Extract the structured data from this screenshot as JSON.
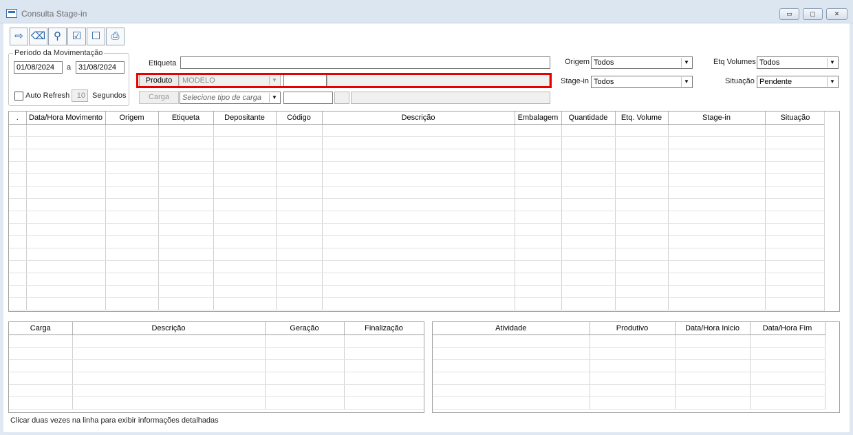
{
  "window": {
    "title": "Consulta Stage-in",
    "minimize": "▭",
    "maximize": "▢",
    "close": "✕"
  },
  "toolbar": [
    {
      "name": "exit-icon",
      "glyph": "⇨"
    },
    {
      "name": "eraser-icon",
      "glyph": "⌫"
    },
    {
      "name": "search-icon",
      "glyph": "⚲"
    },
    {
      "name": "check-list-icon",
      "glyph": "☑"
    },
    {
      "name": "uncheck-list-icon",
      "glyph": "☐"
    },
    {
      "name": "print-icon",
      "glyph": "⎙"
    }
  ],
  "periodo": {
    "label": "Período da Movimentação",
    "start": "01/08/2024",
    "sep": "a",
    "end": "31/08/2024"
  },
  "auto_refresh": {
    "label": "Auto Refresh",
    "seconds": "10",
    "unit": "Segundos"
  },
  "filters": {
    "etiqueta_label": "Etiqueta",
    "produto_button": "Produto",
    "produto_combo": "MODELO",
    "carga_button": "Carga",
    "carga_combo": "Selecione tipo de carga",
    "origem_label": "Origem",
    "origem_value": "Todos",
    "stagein_label": "Stage-in",
    "stagein_value": "Todos",
    "etq_volumes_label": "Etq Volumes",
    "etq_volumes_value": "Todos",
    "situacao_label": "Situação",
    "situacao_value": "Pendente"
  },
  "main_grid": {
    "columns": [
      ".",
      "Data/Hora Movimento",
      "Origem",
      "Etiqueta",
      "Depositante",
      "Código",
      "Descrição",
      "Embalagem",
      "Quantidade",
      "Etq. Volume",
      "Stage-in",
      "Situação"
    ]
  },
  "carga_grid": {
    "columns": [
      "Carga",
      "Descrição",
      "Geração",
      "Finalização"
    ]
  },
  "atividade_grid": {
    "columns": [
      "Atividade",
      "Produtivo",
      "Data/Hora Inicio",
      "Data/Hora Fim"
    ]
  },
  "status_text": "Clicar duas vezes na linha para exibir informações detalhadas"
}
